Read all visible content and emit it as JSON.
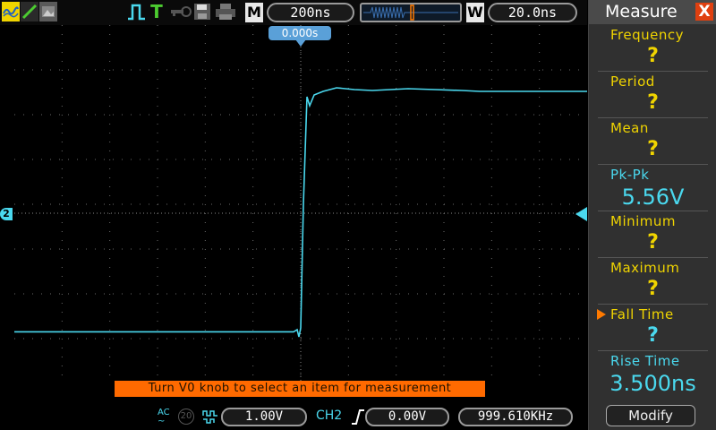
{
  "colors": {
    "trace": "#4ad8ee",
    "grid": "#6a6a6a",
    "accent": "#ff6a00",
    "label_yellow": "#f0d400",
    "panel_bg": "#303030"
  },
  "toolbar": {
    "icons": [
      "waveform-icon",
      "line-icon",
      "image-icon",
      "pulse-icon",
      "trigger-icon",
      "key-icon",
      "save-icon",
      "print-icon"
    ],
    "trigger_letter": "T",
    "timebase_letter": "M",
    "timebase": "200ns",
    "window_letter": "W",
    "window_value": "20.0ns"
  },
  "screen": {
    "trigger_position": "0.000s",
    "channel_marker": "2",
    "message": "Turn V0 knob to select an item for measurement"
  },
  "statusbar": {
    "coupling": "AC",
    "bandwidth_label": "20",
    "volts_per_div": "1.00V",
    "trigger_channel": "CH2",
    "trigger_level": "0.00V",
    "frequency": "999.610KHz"
  },
  "measure": {
    "title": "Measure",
    "close": "X",
    "items": [
      {
        "label": "Frequency",
        "value": "?"
      },
      {
        "label": "Period",
        "value": "?"
      },
      {
        "label": "Mean",
        "value": "?"
      },
      {
        "label": "Pk-Pk",
        "value": "5.56V"
      },
      {
        "label": "Minimum",
        "value": "?"
      },
      {
        "label": "Maximum",
        "value": "?"
      },
      {
        "label": "Fall Time",
        "value": "?"
      },
      {
        "label": "Rise Time",
        "value": "3.500ns"
      }
    ],
    "selected_item": "Fall Time",
    "modify_label": "Modify"
  }
}
